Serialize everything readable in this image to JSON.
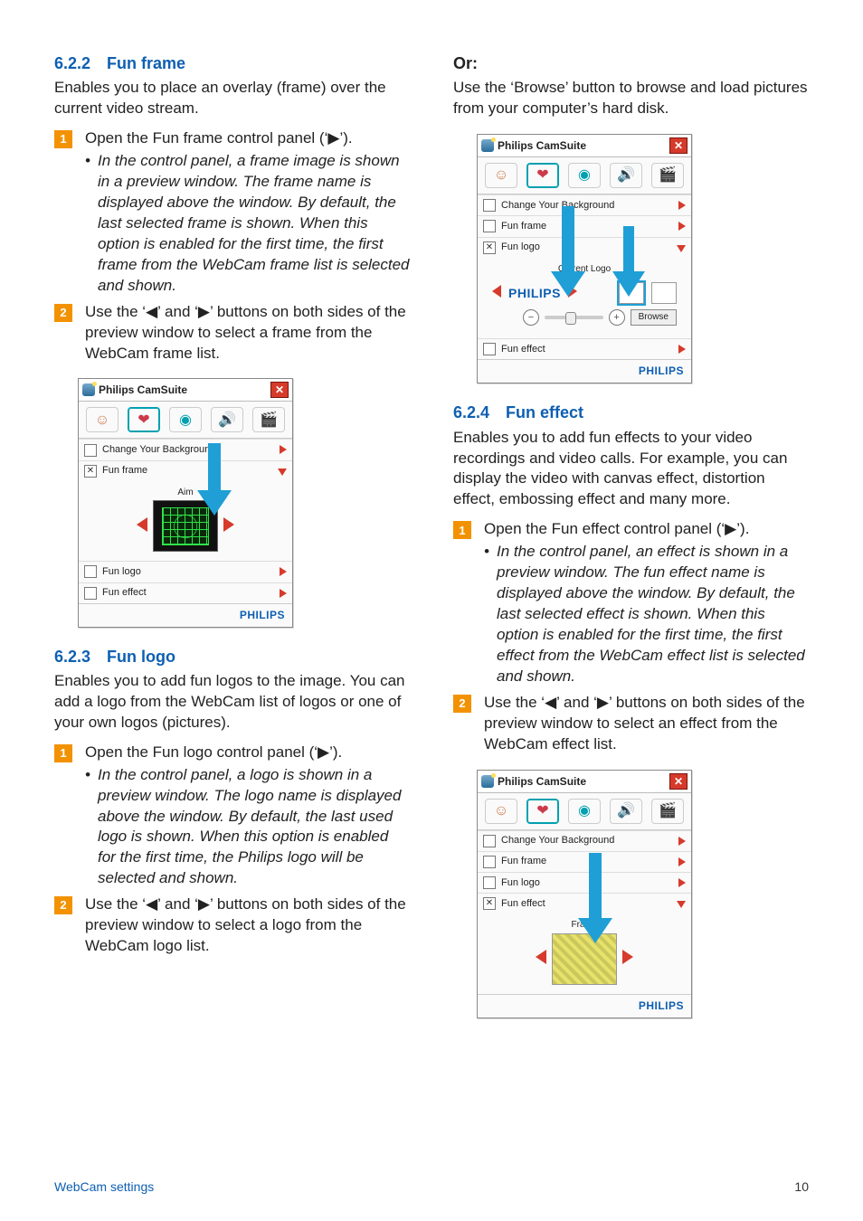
{
  "footer": {
    "section": "WebCam settings",
    "page": "10"
  },
  "camsuite": {
    "title": "Philips CamSuite",
    "brand": "PHILIPS",
    "rows": {
      "change_bg": "Change Your Background",
      "fun_frame": "Fun frame",
      "fun_logo": "Fun logo",
      "fun_effect": "Fun effect"
    },
    "aim_label": "Aim",
    "current_logo_label": "Current Logo",
    "browse": "Browse",
    "frame_label": "Frame"
  },
  "s622": {
    "heading": "6.2.2 Fun frame",
    "intro": "Enables you to place an overlay (frame) over the current video stream.",
    "step1": "Open the Fun frame control panel (‘▶’).",
    "step1_bullet": "In the control panel, a frame image is shown in a preview window.  The frame name is displayed above the window. By default, the last selected frame is shown.  When this option is enabled for the first time, the first frame from the WebCam frame list is selected and shown.",
    "step2": "Use the ‘◀’ and ‘▶’ buttons on both sides of the preview window to select a frame from the WebCam frame list."
  },
  "s623": {
    "heading": "6.2.3 Fun logo",
    "intro": "Enables you to add fun logos to the image. You can add a logo from the WebCam list of logos or one of your own logos (pictures).",
    "step1": "Open the Fun logo control panel (‘▶’).",
    "step1_bullet": "In the control panel, a logo is shown in a preview window.  The logo name is displayed above the window. By default, the last used logo is shown.  When this option is enabled for the first time, the Philips logo will be selected and shown.",
    "step2": "Use the ‘◀’ and ‘▶’ buttons on both sides of the preview window to select a logo from the WebCam logo list."
  },
  "or": {
    "heading": "Or:",
    "text": "Use the ‘Browse’ button to browse and load pictures from your computer’s hard disk."
  },
  "s624": {
    "heading": "6.2.4 Fun effect",
    "intro": "Enables you to add fun effects to your video recordings and video calls. For example, you can display the video with canvas effect, distortion effect, embossing effect and many more.",
    "step1": "Open the Fun effect control panel (‘▶’).",
    "step1_bullet": "In the control panel, an effect is shown in a preview window.  The fun effect name is displayed above the window. By default, the last selected effect is shown.  When this option is enabled for the first time, the first effect from the WebCam effect list is selected and shown.",
    "step2": "Use the ‘◀’ and ‘▶’ buttons on both sides of the preview window to select an effect from the WebCam effect list."
  }
}
